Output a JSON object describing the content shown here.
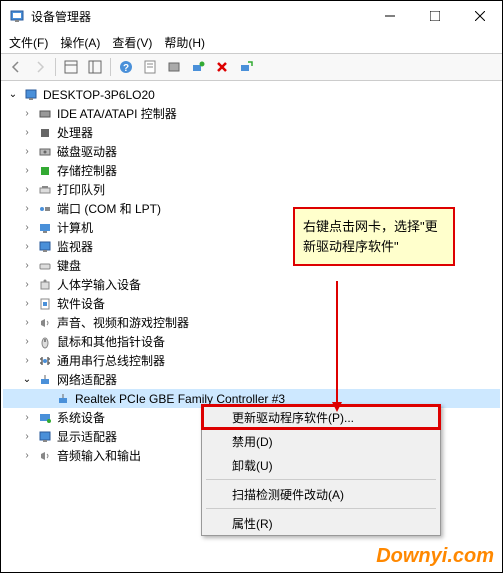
{
  "window": {
    "title": "设备管理器"
  },
  "menu": {
    "file": "文件(F)",
    "action": "操作(A)",
    "view": "查看(V)",
    "help": "帮助(H)"
  },
  "tree": {
    "root": "DESKTOP-3P6LO20",
    "items": [
      "IDE ATA/ATAPI 控制器",
      "处理器",
      "磁盘驱动器",
      "存储控制器",
      "打印队列",
      "端口 (COM 和 LPT)",
      "计算机",
      "监视器",
      "键盘",
      "人体学输入设备",
      "软件设备",
      "声音、视频和游戏控制器",
      "鼠标和其他指针设备",
      "通用串行总线控制器"
    ],
    "net_adapter": "网络适配器",
    "selected": "Realtek PCIe GBE Family Controller #3",
    "tail": [
      "系统设备",
      "显示适配器",
      "音频输入和输出"
    ]
  },
  "context": {
    "update": "更新驱动程序软件(P)...",
    "disable": "禁用(D)",
    "uninstall": "卸载(U)",
    "scan": "扫描检测硬件改动(A)",
    "props": "属性(R)"
  },
  "callout": "右键点击网卡，选择\"更新驱动程序软件\"",
  "watermark": "Downyi.com"
}
